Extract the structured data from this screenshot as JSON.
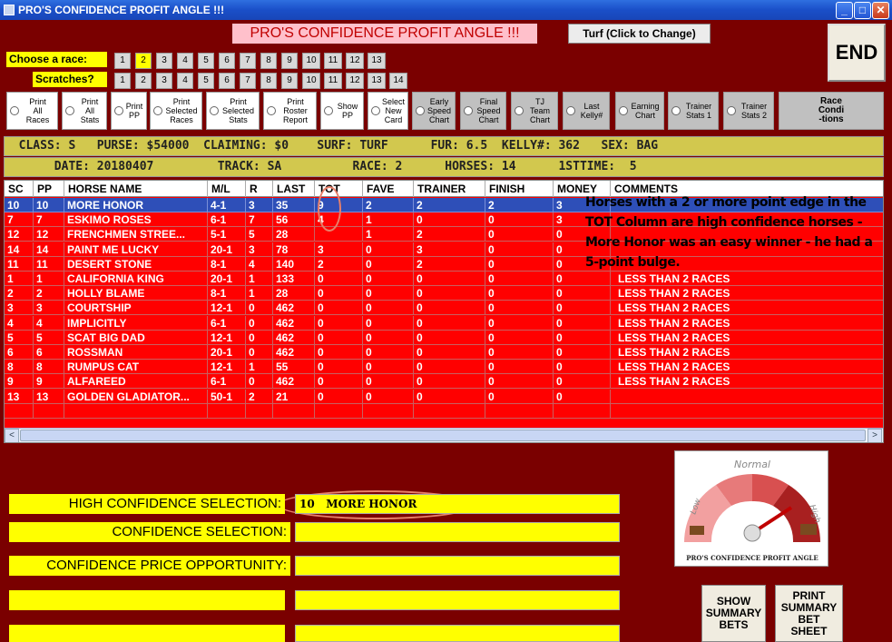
{
  "window": {
    "title": "PRO'S CONFIDENCE PROFIT ANGLE !!!",
    "minimize": "_",
    "maximize": "□",
    "close": "✕"
  },
  "header": {
    "title": "PRO'S CONFIDENCE PROFIT ANGLE !!!",
    "turf_button": "Turf (Click to Change)",
    "end_button": "END"
  },
  "race_select": {
    "label": "Choose  a race:",
    "buttons": [
      "1",
      "2",
      "3",
      "4",
      "5",
      "6",
      "7",
      "8",
      "9",
      "10",
      "11",
      "12",
      "13"
    ],
    "active": "2"
  },
  "scratches": {
    "label": "Scratches?",
    "buttons": [
      "1",
      "2",
      "3",
      "4",
      "5",
      "6",
      "7",
      "8",
      "9",
      "10",
      "11",
      "12",
      "13",
      "14"
    ]
  },
  "options": [
    {
      "label": "Print\nAll\nRaces"
    },
    {
      "label": "Print\nAll\nStats"
    },
    {
      "label": "Print\nPP"
    },
    {
      "label": "Print\nSelected\nRaces"
    },
    {
      "label": "Print\nSelected\nStats"
    },
    {
      "label": "Print\nRoster\nReport"
    },
    {
      "label": "Show\nPP"
    },
    {
      "label": "Select\nNew\nCard"
    },
    {
      "label": "Early\nSpeed\nChart"
    },
    {
      "label": "Final\nSpeed\nChart"
    },
    {
      "label": "TJ\nTeam\nChart"
    },
    {
      "label": "Last\nKelly#"
    },
    {
      "label": "Earning\nChart"
    },
    {
      "label": "Trainer\nStats 1"
    },
    {
      "label": "Trainer\nStats 2"
    },
    {
      "label": "Race\nCondi\n-tions"
    }
  ],
  "info1": "  CLASS: S   PURSE: $54000  CLAIMING: $0    SURF: TURF      FUR: 6.5  KELLY#: 362   SEX: BAG",
  "info2": "       DATE: 20180407         TRACK: SA          RACE: 2      HORSES: 14      1STTIME:  5",
  "table": {
    "headers": [
      "SC",
      "PP",
      "HORSE NAME",
      "M/L",
      "R",
      "LAST",
      "TOT",
      "FAVE",
      "TRAINER",
      "FINISH",
      "MONEY",
      "COMMENTS"
    ],
    "rows": [
      [
        "10",
        "10",
        "MORE HONOR",
        "4-1",
        "3",
        "35",
        "9",
        "2",
        "2",
        "2",
        "3",
        ""
      ],
      [
        "7",
        "7",
        "ESKIMO ROSES",
        "6-1",
        "7",
        "56",
        "4",
        "1",
        "0",
        "0",
        "3",
        ""
      ],
      [
        "12",
        "12",
        "FRENCHMEN STREE...",
        "5-1",
        "5",
        "28",
        "",
        "1",
        "2",
        "0",
        "0",
        ""
      ],
      [
        "14",
        "14",
        "PAINT ME LUCKY",
        "20-1",
        "3",
        "78",
        "3",
        "0",
        "3",
        "0",
        "0",
        ""
      ],
      [
        "11",
        "11",
        "DESERT STONE",
        "8-1",
        "4",
        "140",
        "2",
        "0",
        "2",
        "0",
        "0",
        ""
      ],
      [
        "1",
        "1",
        "CALIFORNIA KING",
        "20-1",
        "1",
        "133",
        "0",
        "0",
        "0",
        "0",
        "0",
        "LESS THAN 2 RACES"
      ],
      [
        "2",
        "2",
        "HOLLY BLAME",
        "8-1",
        "1",
        "28",
        "0",
        "0",
        "0",
        "0",
        "0",
        "LESS THAN 2 RACES"
      ],
      [
        "3",
        "3",
        "COURTSHIP",
        "12-1",
        "0",
        "462",
        "0",
        "0",
        "0",
        "0",
        "0",
        "LESS THAN 2 RACES"
      ],
      [
        "4",
        "4",
        "IMPLICITLY",
        "6-1",
        "0",
        "462",
        "0",
        "0",
        "0",
        "0",
        "0",
        "LESS THAN 2 RACES"
      ],
      [
        "5",
        "5",
        "SCAT BIG DAD",
        "12-1",
        "0",
        "462",
        "0",
        "0",
        "0",
        "0",
        "0",
        "LESS THAN 2 RACES"
      ],
      [
        "6",
        "6",
        "ROSSMAN",
        "20-1",
        "0",
        "462",
        "0",
        "0",
        "0",
        "0",
        "0",
        "LESS THAN 2 RACES"
      ],
      [
        "8",
        "8",
        "RUMPUS CAT",
        "12-1",
        "1",
        "55",
        "0",
        "0",
        "0",
        "0",
        "0",
        "LESS THAN 2 RACES"
      ],
      [
        "9",
        "9",
        "ALFAREED",
        "6-1",
        "0",
        "462",
        "0",
        "0",
        "0",
        "0",
        "0",
        "LESS THAN 2 RACES"
      ],
      [
        "13",
        "13",
        "GOLDEN GLADIATOR...",
        "50-1",
        "2",
        "21",
        "0",
        "0",
        "0",
        "0",
        "0",
        ""
      ]
    ]
  },
  "annotation": "Horses with a 2 or more point edge in the TOT Column are high confidence horses - More Honor was an easy winner - he had a 5-point bulge.",
  "selections": {
    "high_label": "HIGH CONFIDENCE SELECTION:",
    "high_value": "10   MORE HONOR",
    "conf_label": "CONFIDENCE SELECTION:",
    "conf_value": "",
    "price_label": "CONFIDENCE PRICE OPPORTUNITY:",
    "price_value": ""
  },
  "gauge": {
    "normal": "Normal",
    "low": "Low",
    "high": "High",
    "caption": "PRO'S CONFIDENCE PROFIT ANGLE"
  },
  "buttons": {
    "show_summary": "SHOW\nSUMMARY\nBETS",
    "print_summary": "PRINT\nSUMMARY\nBET\nSHEET"
  },
  "colors": {
    "background": "#7a0000",
    "grid": "#ff0000",
    "selected_row": "#2e4fb8",
    "highlight": "#ffff00"
  }
}
